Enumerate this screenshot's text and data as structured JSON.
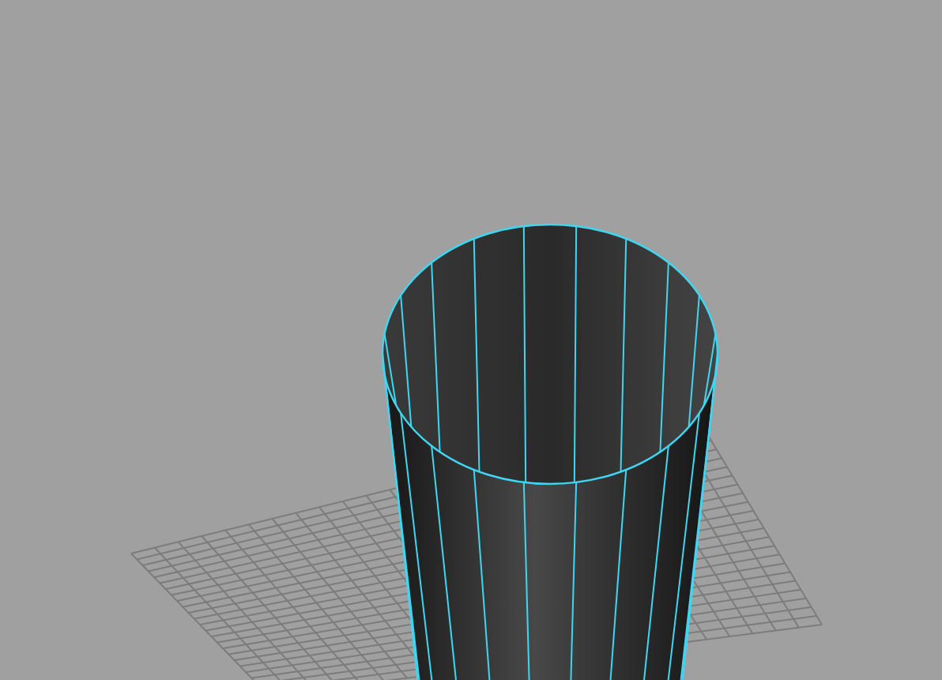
{
  "viewport": {
    "object_selected": true,
    "grid_visible": true
  }
}
